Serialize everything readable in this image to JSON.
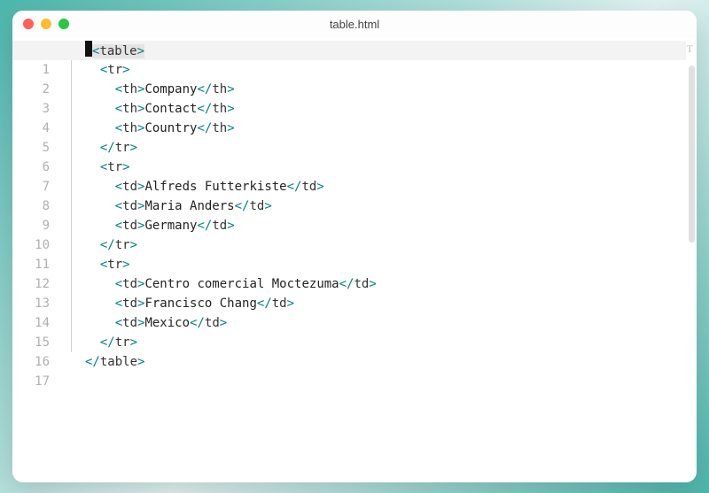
{
  "window": {
    "title": "table.html"
  },
  "gutter": {
    "outer": "1",
    "lines": [
      "1",
      "2",
      "3",
      "4",
      "5",
      "6",
      "7",
      "8",
      "9",
      "10",
      "11",
      "12",
      "13",
      "14",
      "15",
      "16",
      "17"
    ]
  },
  "code": {
    "tableOpen": "table",
    "tableClose": "table",
    "tr": "tr",
    "th": "th",
    "td": "td",
    "headers": [
      "Company",
      "Contact",
      "Country"
    ],
    "row1": [
      "Alfreds Futterkiste",
      "Maria Anders",
      "Germany"
    ],
    "row2": [
      "Centro comercial Moctezuma",
      "Francisco Chang",
      "Mexico"
    ]
  },
  "glyph": "T"
}
